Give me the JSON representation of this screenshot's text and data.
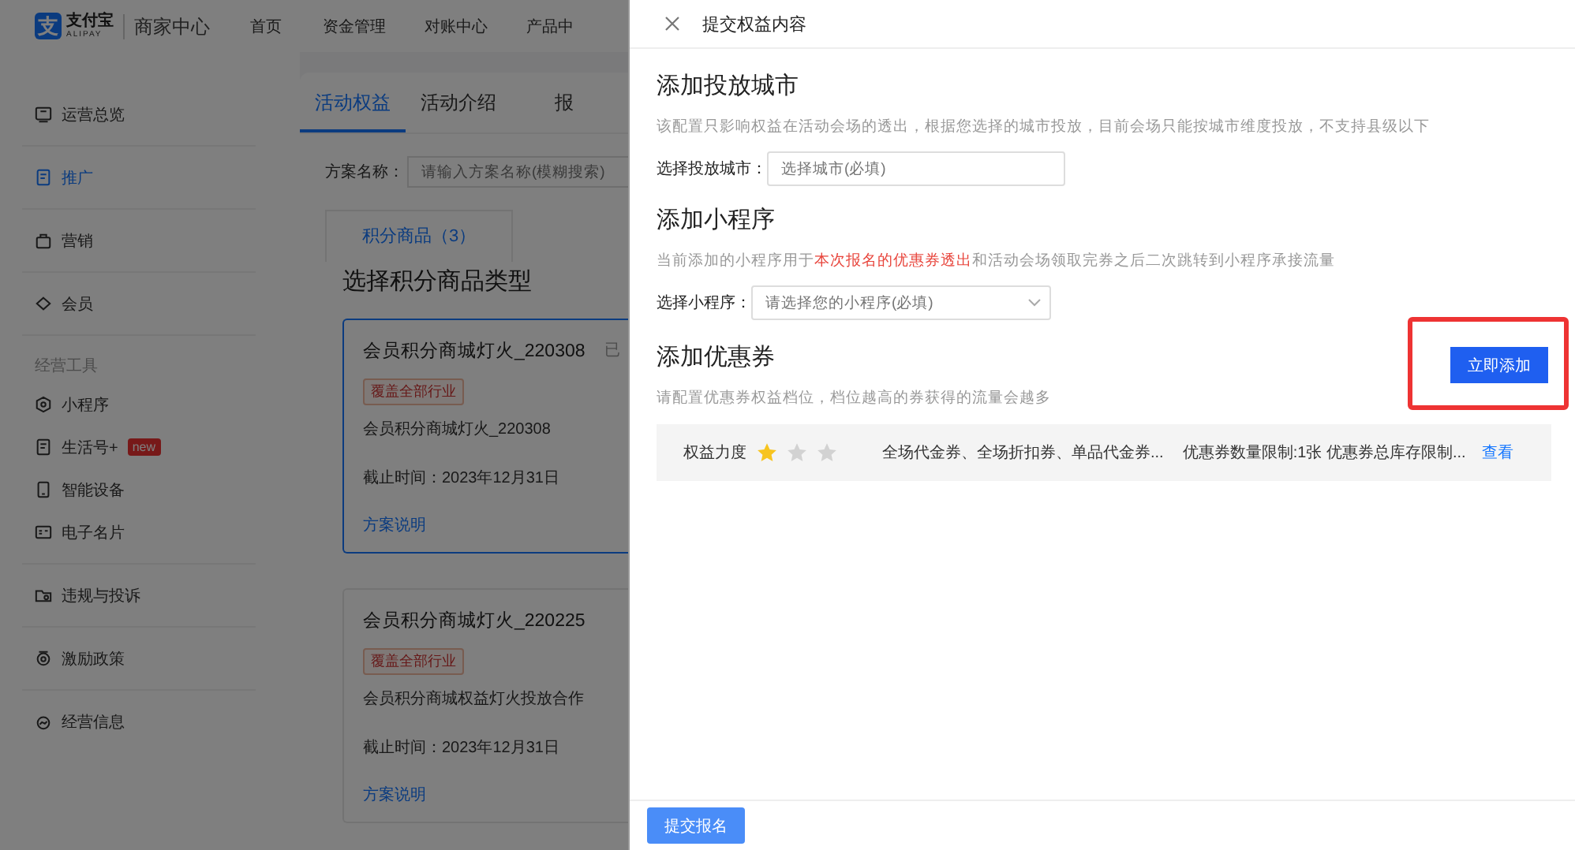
{
  "header": {
    "logo": {
      "mark": "支",
      "name": "支付宝",
      "latin": "ALIPAY",
      "product": "商家中心"
    },
    "nav": [
      {
        "label": "首页"
      },
      {
        "label": "资金管理"
      },
      {
        "label": "对账中心"
      },
      {
        "label": "产品中"
      }
    ]
  },
  "sidebar": {
    "groups": [
      {
        "items": [
          {
            "label": "运营总览",
            "selected": false
          }
        ]
      },
      {
        "items": [
          {
            "label": "推广",
            "selected": true
          }
        ]
      },
      {
        "items": [
          {
            "label": "营销",
            "selected": false
          }
        ]
      },
      {
        "items": [
          {
            "label": "会员",
            "selected": false
          }
        ]
      },
      {
        "title": "经营工具",
        "items": [
          {
            "label": "小程序",
            "selected": false
          },
          {
            "label": "生活号+",
            "selected": false,
            "badge": "new"
          },
          {
            "label": "智能设备",
            "selected": false
          },
          {
            "label": "电子名片",
            "selected": false
          }
        ]
      },
      {
        "items": [
          {
            "label": "违规与投诉",
            "selected": false
          }
        ]
      },
      {
        "items": [
          {
            "label": "激励政策",
            "selected": false
          }
        ]
      },
      {
        "items": [
          {
            "label": "经营信息",
            "selected": false
          }
        ]
      }
    ]
  },
  "main": {
    "tabs": [
      {
        "label": "活动权益",
        "selected": true
      },
      {
        "label": "活动介绍",
        "selected": false
      },
      {
        "label": "报",
        "selected": false
      }
    ],
    "search": {
      "label": "方案名称：",
      "placeholder": "请输入方案名称(模糊搜索)"
    },
    "sub_tab": {
      "label": "积分商品（3）",
      "selected": true
    },
    "heading": "选择积分商品类型",
    "cards": [
      {
        "title": "会员积分商城灯火_220308",
        "status": "已",
        "selected": true,
        "tag": "覆盖全部行业",
        "description": "会员积分商城灯火_220308",
        "deadline": "截止时间：2023年12月31日",
        "link": "方案说明"
      },
      {
        "title": "会员积分商城灯火_220225",
        "selected": false,
        "tag": "覆盖全部行业",
        "description": "会员积分商城权益灯火投放合作",
        "deadline": "截止时间：2023年12月31日",
        "link": "方案说明"
      }
    ]
  },
  "drawer": {
    "title": "提交权益内容",
    "sections": [
      {
        "kind": "city",
        "title": "添加投放城市",
        "description": [
          {
            "text": "该配置只影响权益在活动会场的透出，根据您选择的城市投放，目前会场只能按城市维度投放，不支持县级以下",
            "highlight": false
          }
        ],
        "field": {
          "label": "选择投放城市：",
          "placeholder": "选择城市(必填)",
          "dropdown": false
        }
      },
      {
        "kind": "miniapp",
        "title": "添加小程序",
        "description": [
          {
            "text": "当前添加的小程序用于",
            "highlight": false
          },
          {
            "text": "本次报名的优惠券透出",
            "highlight": true
          },
          {
            "text": "和活动会场领取完券之后二次跳转到小程序承接流量",
            "highlight": false
          }
        ],
        "field": {
          "label": "选择小程序：",
          "placeholder": "请选择您的小程序(必填)",
          "dropdown": true
        }
      },
      {
        "kind": "coupon",
        "title": "添加优惠券",
        "description": [
          {
            "text": "请配置优惠券权益档位，档位越高的券获得的流量会越多",
            "highlight": false
          }
        ],
        "add_button": {
          "label": "立即添加",
          "highlighted": true
        },
        "coupon": {
          "label": "权益力度",
          "stars": 1,
          "types": "全场代金券、全场折扣券、单品代金券...",
          "limits": "优惠券数量限制:1张 优惠券总库存限制...",
          "link": "查看"
        }
      }
    ],
    "submit": "提交报名"
  }
}
